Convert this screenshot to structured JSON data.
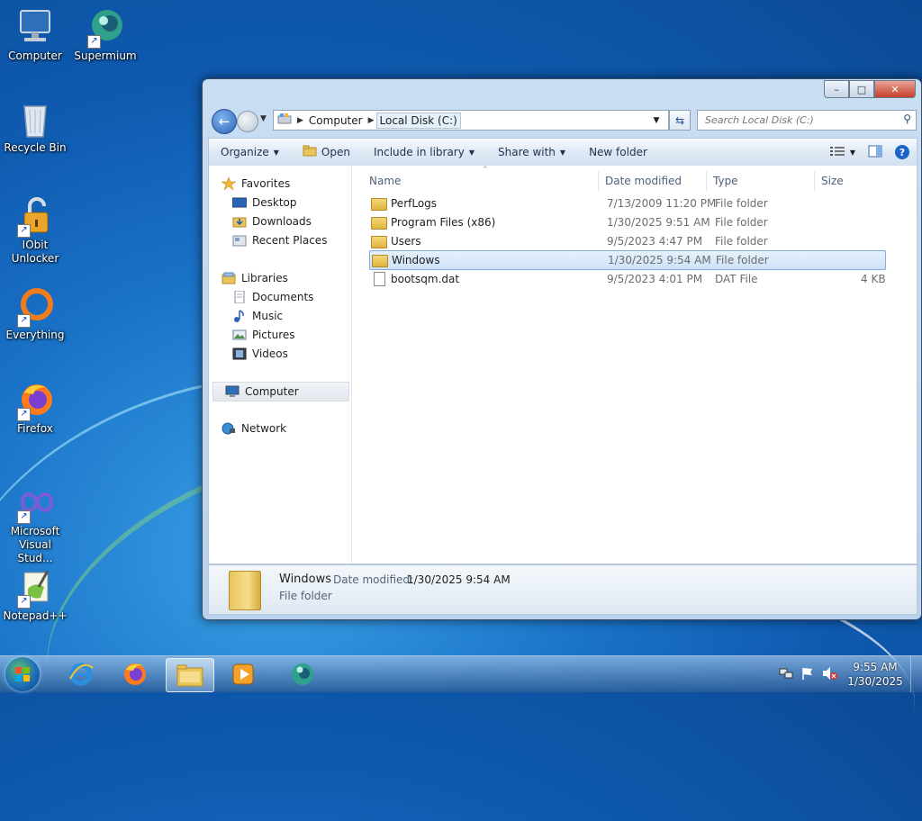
{
  "desktop": {
    "icons": [
      {
        "label": "Computer",
        "icon": "computer-icon"
      },
      {
        "label": "Supermium",
        "icon": "supermium-icon"
      },
      {
        "label": "Recycle Bin",
        "icon": "recycle-bin-icon"
      },
      {
        "label": "IObit Unlocker",
        "icon": "iobit-unlocker-icon"
      },
      {
        "label": "Everything",
        "icon": "everything-icon"
      },
      {
        "label": "Firefox",
        "icon": "firefox-icon"
      },
      {
        "label": "Microsoft Visual Stud...",
        "icon": "visual-studio-icon"
      },
      {
        "label": "Notepad++",
        "icon": "notepadpp-icon"
      }
    ]
  },
  "window": {
    "caption_buttons": {
      "minimize": "–",
      "maximize": "□",
      "close": "✕"
    },
    "address": {
      "crumbs": [
        "Computer",
        "Local Disk (C:)"
      ]
    },
    "search": {
      "placeholder": "Search Local Disk (C:)"
    },
    "toolbar": {
      "organize": "Organize",
      "open": "Open",
      "include_in_library": "Include in library",
      "share_with": "Share with",
      "new_folder": "New folder"
    },
    "nav": {
      "favorites": "Favorites",
      "desktop": "Desktop",
      "downloads": "Downloads",
      "recent_places": "Recent Places",
      "libraries": "Libraries",
      "documents": "Documents",
      "music": "Music",
      "pictures": "Pictures",
      "videos": "Videos",
      "computer": "Computer",
      "network": "Network"
    },
    "columns": {
      "name": "Name",
      "date": "Date modified",
      "type": "Type",
      "size": "Size"
    },
    "files": [
      {
        "name": "PerfLogs",
        "date": "7/13/2009 11:20 PM",
        "type": "File folder",
        "size": "",
        "kind": "folder"
      },
      {
        "name": "Program Files (x86)",
        "date": "1/30/2025 9:51 AM",
        "type": "File folder",
        "size": "",
        "kind": "folder"
      },
      {
        "name": "Users",
        "date": "9/5/2023 4:47 PM",
        "type": "File folder",
        "size": "",
        "kind": "folder"
      },
      {
        "name": "Windows",
        "date": "1/30/2025 9:54 AM",
        "type": "File folder",
        "size": "",
        "kind": "folder",
        "selected": true
      },
      {
        "name": "bootsqm.dat",
        "date": "9/5/2023 4:01 PM",
        "type": "DAT File",
        "size": "4 KB",
        "kind": "file"
      }
    ],
    "details": {
      "name": "Windows",
      "date_label": "Date modified:",
      "date_value": "1/30/2025 9:54 AM",
      "type": "File folder"
    }
  },
  "taskbar": {
    "items": [
      "internet-explorer-icon",
      "firefox-icon",
      "file-explorer-icon",
      "media-player-icon",
      "supermium-icon"
    ],
    "clock": {
      "time": "9:55 AM",
      "date": "1/30/2025"
    }
  },
  "colors": {
    "selection": "#cde2f8",
    "accent": "#1e63c7"
  }
}
